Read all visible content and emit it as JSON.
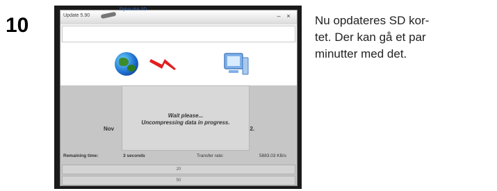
{
  "step": {
    "number": "10"
  },
  "window": {
    "title": "Update 5.90",
    "drive_label": "Flybar disk SD",
    "buttons": {
      "minimize": "–",
      "close": "×"
    }
  },
  "progress_dialog": {
    "line1": "Wait please...",
    "line2": "Uncompressing data in progress."
  },
  "status": {
    "now_left": "Nov",
    "now_right": "02.",
    "remaining_label": "Remaining time:",
    "remaining_value": "3 seconds",
    "transfer_label": "Transfer rate:",
    "transfer_value": "5883.03 KB/s",
    "bar1_text": "20",
    "bar2_text": "50"
  },
  "description": {
    "lines": [
      "Nu opdateres SD kor-",
      "tet. Der  kan gå et par",
      "minutter med det."
    ]
  },
  "colors": {
    "globe_blue": "#1f6fd0",
    "bolt_red": "#e02020",
    "panel_gray": "#c6c6c6",
    "screenshot_frame": "#1a1a1a"
  }
}
